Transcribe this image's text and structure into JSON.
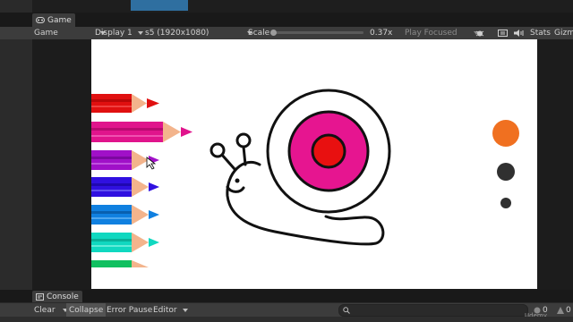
{
  "game_tab": {
    "label": "Game"
  },
  "toolbar": {
    "mode": "Game",
    "display": "Display 1",
    "resolution": "s5 (1920x1080)",
    "scale_label": "Scale",
    "scale_value": "0.37x",
    "play_mode": "Play Focused",
    "stats": "Stats",
    "gizmos": "Gizm"
  },
  "console_tab": {
    "label": "Console"
  },
  "console_toolbar": {
    "clear": "Clear",
    "collapse": "Collapse",
    "error_pause": "Error Pause",
    "editor": "Editor",
    "error_count": "0",
    "warning_count": "0"
  },
  "watermark": "Udemy",
  "colors": {
    "pencils": [
      "#e01010",
      "#e0148c",
      "#a010c8",
      "#3010e0",
      "#1080e0",
      "#10d8c0",
      "#10c060"
    ],
    "swatches": [
      "#f07020",
      "#303030",
      "#303030"
    ],
    "snail_shell_outer": "#e61590",
    "snail_shell_inner": "#e81010"
  }
}
